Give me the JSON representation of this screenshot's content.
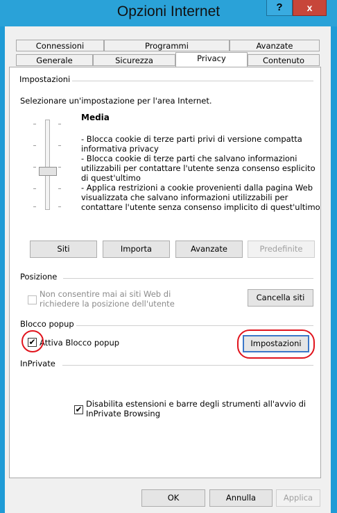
{
  "window": {
    "title": "Opzioni Internet",
    "help_glyph": "?",
    "close_glyph": "x"
  },
  "tabs_row1": [
    "Connessioni",
    "Programmi",
    "Avanzate"
  ],
  "tabs_row2": [
    "Generale",
    "Sicurezza",
    "Privacy",
    "Contenuto"
  ],
  "active_tab": "Privacy",
  "settings": {
    "group_label": "Impostazioni",
    "prompt": "Selezionare un'impostazione per l'area Internet.",
    "level_title": "Media",
    "description": [
      "- Blocca cookie di terze parti privi di versione compatta",
      "informativa privacy",
      "- Blocca cookie di terze parti che salvano informazioni",
      "utilizzabili per contattare l'utente senza consenso esplicito",
      "di quest'ultimo",
      "- Applica restrizioni a cookie provenienti dalla pagina Web",
      "visualizzata che salvano informazioni utilizzabili per",
      "contattare l'utente senza consenso implicito di quest'ultimo"
    ],
    "buttons": {
      "sites": "Siti",
      "import": "Importa",
      "advanced": "Avanzate",
      "default": "Predefinite"
    }
  },
  "location": {
    "group_label": "Posizione",
    "checkbox_line1": "Non consentire mai ai siti Web di",
    "checkbox_line2": "richiedere la posizione dell'utente",
    "clear_button": "Cancella siti"
  },
  "popup": {
    "group_label": "Blocco popup",
    "checkbox_label": "Attiva Blocco popup",
    "checked_glyph": "✔",
    "settings_button": "Impostazioni"
  },
  "inprivate": {
    "group_label": "InPrivate",
    "checkbox_line1": "Disabilita estensioni e barre degli strumenti all'avvio di",
    "checkbox_line2": "InPrivate Browsing"
  },
  "footer": {
    "ok": "OK",
    "cancel": "Annulla",
    "apply": "Applica"
  }
}
